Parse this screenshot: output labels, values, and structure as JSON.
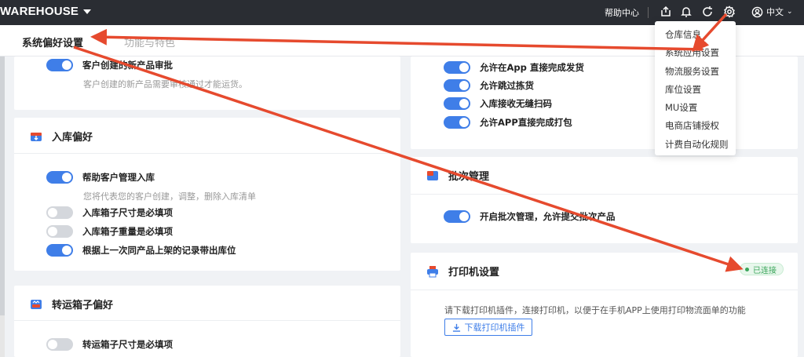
{
  "topbar": {
    "brand": "WAREHOUSE",
    "help_label": "帮助中心",
    "language": "中文",
    "icons": [
      "export-icon",
      "bell-icon",
      "refresh-icon",
      "gear-icon",
      "user-icon"
    ]
  },
  "header": {
    "tabs": [
      {
        "label": "系统偏好设置",
        "active": true
      },
      {
        "label": "功能与特色",
        "active": false
      }
    ]
  },
  "cards": {
    "product": {
      "toggle_label": "客户创建的新产品审批",
      "toggle_on": true,
      "description": "客户创建的新产品需要审核通过才能运货。"
    },
    "inbound": {
      "title": "入库偏好",
      "rows": [
        {
          "label": "帮助客户管理入库",
          "on": true
        },
        {
          "label": "入库箱子尺寸是必填项",
          "on": false
        },
        {
          "label": "入库箱子重量是必填项",
          "on": false
        },
        {
          "label": "根据上一次同产品上架的记录带出库位",
          "on": true
        }
      ],
      "description": "您将代表您的客户创建，调整，删除入库清单"
    },
    "shipping_box": {
      "title": "转运箱子偏好",
      "rows": [
        {
          "label": "转运箱子尺寸是必填项",
          "on": false
        }
      ]
    },
    "app": {
      "rows": [
        {
          "label": "允许在App 直接完成发货",
          "on": true
        },
        {
          "label": "允许跳过拣货",
          "on": true
        },
        {
          "label": "入库接收无缝扫码",
          "on": true
        },
        {
          "label": "允许APP直接完成打包",
          "on": true
        }
      ]
    },
    "batch": {
      "title": "批次管理",
      "rows": [
        {
          "label": "开启批次管理，允许提交批次产品",
          "on": true
        }
      ]
    },
    "printer": {
      "title": "打印机设置",
      "status": "已连接",
      "note": "请下载打印机插件，连接打印机，以便于在手机APP上使用打印物流面单的功能",
      "download_label": "下载打印机插件"
    }
  },
  "dropdown": {
    "items": [
      "仓库信息",
      "系统应用设置",
      "物流服务设置",
      "库位设置",
      "MU设置",
      "电商店铺授权",
      "计费自动化规则"
    ]
  },
  "colors": {
    "topbar": "#2a2d33",
    "accent": "#3f7ee8",
    "annotation": "#e64a2e",
    "connected": "#3aa55a"
  }
}
